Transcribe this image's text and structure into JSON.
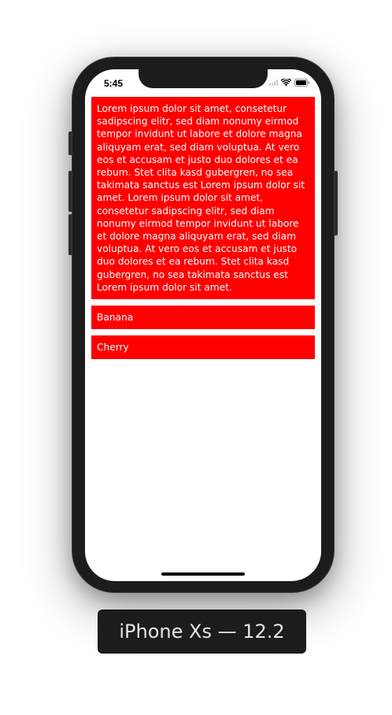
{
  "status_bar": {
    "time": "5:45",
    "icons": [
      "signal-icon",
      "wifi-icon",
      "battery-icon"
    ]
  },
  "list": {
    "items": [
      {
        "text": "Lorem ipsum dolor sit amet, consetetur sadipscing elitr, sed diam nonumy eirmod tempor invidunt ut labore et dolore magna aliquyam erat, sed diam voluptua. At vero eos et accusam et justo duo dolores et ea rebum. Stet clita kasd gubergren, no sea takimata sanctus est Lorem ipsum dolor sit amet. Lorem ipsum dolor sit amet, consetetur sadipscing elitr, sed diam nonumy eirmod tempor invidunt ut labore et dolore magna aliquyam erat, sed diam voluptua. At vero eos et accusam et justo duo dolores et ea rebum. Stet clita kasd gubergren, no sea takimata sanctus est Lorem ipsum dolor sit amet."
      },
      {
        "text": "Banana"
      },
      {
        "text": "Cherry"
      }
    ]
  },
  "device": {
    "label": "iPhone Xs — 12.2"
  },
  "colors": {
    "cell_background": "#ff0000",
    "cell_text": "#ffffff",
    "phone_frame": "#1c1c1e"
  }
}
